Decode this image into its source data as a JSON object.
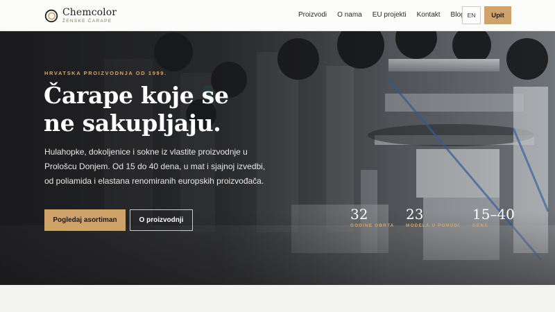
{
  "brand": {
    "name": "Chemcolor",
    "tagline": "ŽENSKE ČARAPE"
  },
  "nav": {
    "items": [
      {
        "label": "Proizvodi"
      },
      {
        "label": "O nama"
      },
      {
        "label": "EU projekti"
      },
      {
        "label": "Kontakt"
      },
      {
        "label": "Blog"
      }
    ],
    "language_label": "EN",
    "cta_label": "Upit"
  },
  "hero": {
    "eyebrow": "HRVATSKA PROIZVODNJA OD 1999.",
    "headline_line1": "Čarape koje se",
    "headline_line2": "ne sakupljaju.",
    "lede": "Hulahopke, dokoljenice i sokne iz vlastite proizvodnje u Prološcu Donjem. Od 15 do 40 dena, u mat i sjajnoj izvedbi, od poliamida i elastana renomiranih europskih proizvođača.",
    "primary_button": "Pogledaj asortiman",
    "secondary_button": "O proizvodnji",
    "stats": [
      {
        "value": "32",
        "label": "GODINE OBRTA"
      },
      {
        "value": "23",
        "label": "MODELA U PONUDI"
      },
      {
        "value": "15–40",
        "label": "DENA"
      }
    ]
  },
  "colors": {
    "accent": "#cfa26b",
    "eyebrow": "#d3a66c",
    "header_bg": "#fbfbfa",
    "hero_dark": "#2b2c2e"
  }
}
